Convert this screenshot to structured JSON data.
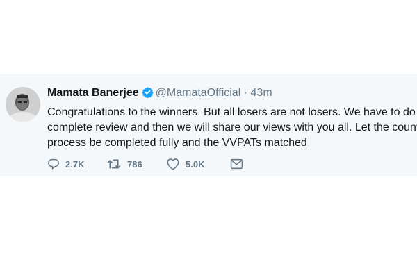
{
  "tweet": {
    "author": {
      "name": "Mamata Banerjee",
      "handle": "@MamataOfficial",
      "verified": true
    },
    "separator": "·",
    "timestamp": "43m",
    "text_lines": [
      "Congratulations to the winners. But all losers are not losers. We have to do a",
      "complete review and then we will share our views with you all. Let the counting",
      "process be completed fully and the VVPATs matched"
    ],
    "actions": {
      "reply": {
        "icon": "reply-icon",
        "count": "2.7K"
      },
      "retweet": {
        "icon": "retweet-icon",
        "count": "786"
      },
      "like": {
        "icon": "heart-icon",
        "count": "5.0K"
      },
      "message": {
        "icon": "envelope-icon"
      }
    }
  },
  "colors": {
    "card_background": "#f5f8fa",
    "verified_blue": "#1da1f2",
    "secondary_text": "#657786",
    "primary_text": "#14171a"
  }
}
